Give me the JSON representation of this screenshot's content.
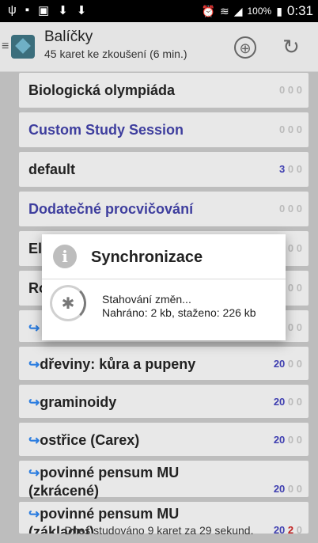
{
  "status_bar": {
    "left_icons": [
      "usb-icon",
      "sim-icon",
      "image-icon",
      "download-icon",
      "download-icon"
    ],
    "battery_text": "100%",
    "time": "0:31"
  },
  "action_bar": {
    "title": "Balíčky",
    "subtitle": "45 karet ke zkoušení (6 min.)",
    "add_icon": "add-circle-icon",
    "sync_icon": "sync-icon"
  },
  "decks": [
    {
      "name": "Biologická olympiáda",
      "style": "dark",
      "subdeck": false,
      "new": 0,
      "learn": 0,
      "review": 0
    },
    {
      "name": "Custom Study Session",
      "style": "blue",
      "subdeck": false,
      "new": 0,
      "learn": 0,
      "review": 0
    },
    {
      "name": "default",
      "style": "dark",
      "subdeck": false,
      "new": 3,
      "learn": 0,
      "review": 0
    },
    {
      "name": "Dodatečné procvičování",
      "style": "blue",
      "subdeck": false,
      "new": 0,
      "learn": 0,
      "review": 0
    },
    {
      "name": "El",
      "style": "dark",
      "subdeck": false,
      "new": 0,
      "learn": 0,
      "review": 0
    },
    {
      "name": "Ro",
      "style": "dark",
      "subdeck": false,
      "new": 0,
      "learn": 0,
      "review": 0
    },
    {
      "name": "",
      "style": "dark",
      "subdeck": true,
      "new": 0,
      "learn": 0,
      "review": 0
    },
    {
      "name": "dřeviny: kůra a pupeny",
      "style": "dark",
      "subdeck": true,
      "new": 20,
      "learn": 0,
      "review": 0
    },
    {
      "name": "graminoidy",
      "style": "dark",
      "subdeck": true,
      "new": 20,
      "learn": 0,
      "review": 0
    },
    {
      "name": "ostřice (Carex)",
      "style": "dark",
      "subdeck": true,
      "new": 20,
      "learn": 0,
      "review": 0
    },
    {
      "name": "povinné pensum MU (zkrácené)",
      "style": "dark",
      "subdeck": true,
      "new": 20,
      "learn": 0,
      "review": 0
    },
    {
      "name": "povinné pensum MU (základní)",
      "style": "dark",
      "subdeck": true,
      "new": 20,
      "learn": 2,
      "review": 0
    }
  ],
  "footer": {
    "text": "Dnes studováno 9 karet za 29 sekund."
  },
  "dialog": {
    "title": "Synchronizace",
    "message_line1": "Stahování změn...",
    "message_line2": "Nahráno: 2 kb, staženo: 226 kb"
  }
}
